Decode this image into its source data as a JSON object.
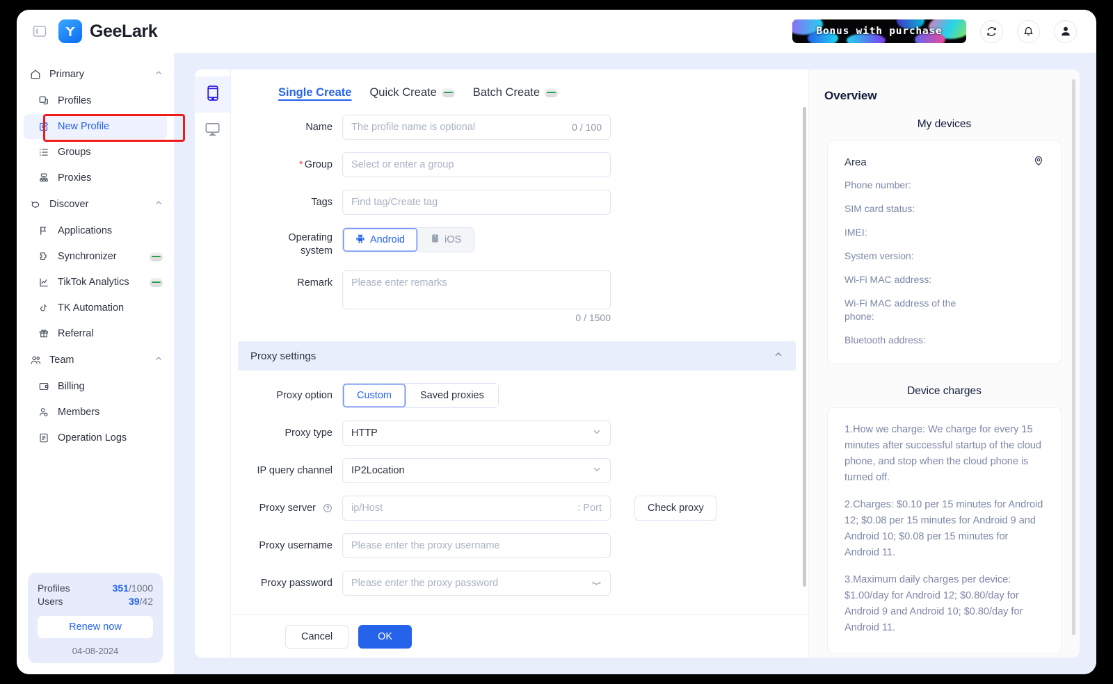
{
  "header": {
    "brand": "GeeLark",
    "promo_text": "Bonus with purchase",
    "panel_toggle_icon": "panel-toggle-icon",
    "refresh_icon": "refresh-icon",
    "bell_icon": "bell-icon",
    "avatar_icon": "user-avatar-icon"
  },
  "sidebar": {
    "groups": [
      {
        "label": "Primary",
        "icon": "home-icon",
        "items": [
          {
            "label": "Profiles",
            "icon": "profiles-icon",
            "active": false,
            "badge": false
          },
          {
            "label": "New Profile",
            "icon": "new-profile-icon",
            "active": true,
            "badge": false
          },
          {
            "label": "Groups",
            "icon": "groups-icon",
            "active": false,
            "badge": false
          },
          {
            "label": "Proxies",
            "icon": "proxies-icon",
            "active": false,
            "badge": false
          }
        ]
      },
      {
        "label": "Discover",
        "icon": "discover-icon",
        "items": [
          {
            "label": "Applications",
            "icon": "applications-icon",
            "active": false,
            "badge": false
          },
          {
            "label": "Synchronizer",
            "icon": "synchronizer-icon",
            "active": false,
            "badge": true
          },
          {
            "label": "TikTok Analytics",
            "icon": "analytics-icon",
            "active": false,
            "badge": true
          },
          {
            "label": "TK Automation",
            "icon": "tiktok-icon",
            "active": false,
            "badge": false
          },
          {
            "label": "Referral",
            "icon": "gift-icon",
            "active": false,
            "badge": false
          }
        ]
      },
      {
        "label": "Team",
        "icon": "team-icon",
        "items": [
          {
            "label": "Billing",
            "icon": "billing-icon",
            "active": false,
            "badge": false
          },
          {
            "label": "Members",
            "icon": "members-icon",
            "active": false,
            "badge": false
          },
          {
            "label": "Operation Logs",
            "icon": "logs-icon",
            "active": false,
            "badge": false
          }
        ]
      }
    ],
    "quota": {
      "profiles_label": "Profiles",
      "profiles_used": "351",
      "profiles_total": "/1000",
      "users_label": "Users",
      "users_used": "39",
      "users_total": "/42",
      "renew_label": "Renew now",
      "date": "04-08-2024"
    }
  },
  "rail": {
    "phone_icon": "phone-device-icon",
    "desktop_icon": "desktop-device-icon"
  },
  "form": {
    "tabs": [
      {
        "label": "Single Create",
        "active": true,
        "badge": false
      },
      {
        "label": "Quick Create",
        "active": false,
        "badge": true
      },
      {
        "label": "Batch Create",
        "active": false,
        "badge": true
      }
    ],
    "name": {
      "label": "Name",
      "placeholder": "The profile name is optional",
      "counter": "0 / 100"
    },
    "group": {
      "label": "Group",
      "required": "*",
      "placeholder": "Select or enter a group"
    },
    "tags": {
      "label": "Tags",
      "placeholder": "Find tag/Create tag"
    },
    "os": {
      "label_line1": "Operating",
      "label_line2": "system",
      "options": [
        {
          "label": "Android",
          "icon": "android-icon",
          "active": true
        },
        {
          "label": "iOS",
          "icon": "apple-icon",
          "active": false
        }
      ]
    },
    "remark": {
      "label": "Remark",
      "placeholder": "Please enter remarks",
      "counter": "0 / 1500"
    },
    "proxy_section": {
      "title": "Proxy settings",
      "collapse_icon": "chevron-up-icon"
    },
    "proxy_option": {
      "label": "Proxy option",
      "options": [
        {
          "label": "Custom",
          "active": true
        },
        {
          "label": "Saved proxies",
          "active": false
        }
      ]
    },
    "proxy_type": {
      "label": "Proxy type",
      "value": "HTTP",
      "caret_icon": "chevron-down-icon"
    },
    "ip_query_channel": {
      "label": "IP query channel",
      "value": "IP2Location",
      "caret_icon": "chevron-down-icon"
    },
    "proxy_server": {
      "label": "Proxy server",
      "help_icon": "help-circle-icon",
      "host_placeholder": "ip/Host",
      "port_placeholder": ": Port",
      "check_label": "Check proxy"
    },
    "proxy_username": {
      "label": "Proxy username",
      "placeholder": "Please enter the proxy username"
    },
    "proxy_password": {
      "label": "Proxy password",
      "placeholder": "Please enter the proxy password",
      "eye_icon": "eye-off-icon"
    },
    "footer": {
      "cancel_label": "Cancel",
      "ok_label": "OK"
    }
  },
  "overview": {
    "title": "Overview",
    "devices_heading": "My devices",
    "area_label": "Area",
    "pin_icon": "location-pin-icon",
    "device_fields": [
      "Phone number:",
      "SIM card status:",
      "IMEI:",
      "System version:",
      "Wi-Fi MAC address:",
      "Wi-Fi MAC address of the phone:",
      "Bluetooth address:"
    ],
    "charges_heading": "Device charges",
    "charges_paragraphs": [
      "1.How we charge: We charge for every 15 minutes after successful startup of the cloud phone, and stop when the cloud phone is turned off.",
      "2.Charges: $0.10 per 15 minutes for Android 12; $0.08 per 15 minutes for Android 9 and Android 10; $0.08 per 15 minutes for Android 11.",
      "3.Maximum daily charges per device: $1.00/day for Android 12; $0.80/day for Android 9 and Android 10; $0.80/day for Android 11."
    ]
  },
  "colors": {
    "accent": "#2563eb",
    "app_bg": "#e8eefc",
    "highlight": "#ef1b1b",
    "required": "#e5484d"
  }
}
